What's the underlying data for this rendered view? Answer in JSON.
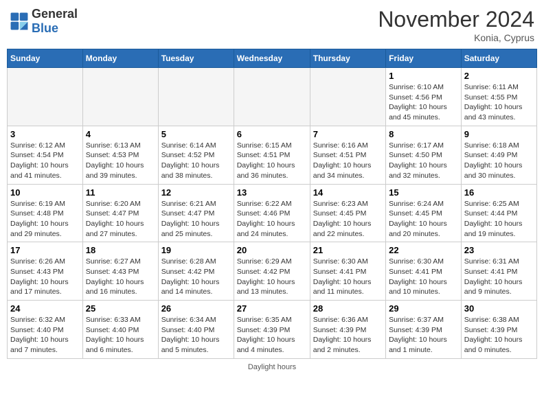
{
  "header": {
    "logo_general": "General",
    "logo_blue": "Blue",
    "title": "November 2024",
    "location": "Konia, Cyprus"
  },
  "days_of_week": [
    "Sunday",
    "Monday",
    "Tuesday",
    "Wednesday",
    "Thursday",
    "Friday",
    "Saturday"
  ],
  "weeks": [
    [
      {
        "day": "",
        "info": ""
      },
      {
        "day": "",
        "info": ""
      },
      {
        "day": "",
        "info": ""
      },
      {
        "day": "",
        "info": ""
      },
      {
        "day": "",
        "info": ""
      },
      {
        "day": "1",
        "info": "Sunrise: 6:10 AM\nSunset: 4:56 PM\nDaylight: 10 hours and 45 minutes."
      },
      {
        "day": "2",
        "info": "Sunrise: 6:11 AM\nSunset: 4:55 PM\nDaylight: 10 hours and 43 minutes."
      }
    ],
    [
      {
        "day": "3",
        "info": "Sunrise: 6:12 AM\nSunset: 4:54 PM\nDaylight: 10 hours and 41 minutes."
      },
      {
        "day": "4",
        "info": "Sunrise: 6:13 AM\nSunset: 4:53 PM\nDaylight: 10 hours and 39 minutes."
      },
      {
        "day": "5",
        "info": "Sunrise: 6:14 AM\nSunset: 4:52 PM\nDaylight: 10 hours and 38 minutes."
      },
      {
        "day": "6",
        "info": "Sunrise: 6:15 AM\nSunset: 4:51 PM\nDaylight: 10 hours and 36 minutes."
      },
      {
        "day": "7",
        "info": "Sunrise: 6:16 AM\nSunset: 4:51 PM\nDaylight: 10 hours and 34 minutes."
      },
      {
        "day": "8",
        "info": "Sunrise: 6:17 AM\nSunset: 4:50 PM\nDaylight: 10 hours and 32 minutes."
      },
      {
        "day": "9",
        "info": "Sunrise: 6:18 AM\nSunset: 4:49 PM\nDaylight: 10 hours and 30 minutes."
      }
    ],
    [
      {
        "day": "10",
        "info": "Sunrise: 6:19 AM\nSunset: 4:48 PM\nDaylight: 10 hours and 29 minutes."
      },
      {
        "day": "11",
        "info": "Sunrise: 6:20 AM\nSunset: 4:47 PM\nDaylight: 10 hours and 27 minutes."
      },
      {
        "day": "12",
        "info": "Sunrise: 6:21 AM\nSunset: 4:47 PM\nDaylight: 10 hours and 25 minutes."
      },
      {
        "day": "13",
        "info": "Sunrise: 6:22 AM\nSunset: 4:46 PM\nDaylight: 10 hours and 24 minutes."
      },
      {
        "day": "14",
        "info": "Sunrise: 6:23 AM\nSunset: 4:45 PM\nDaylight: 10 hours and 22 minutes."
      },
      {
        "day": "15",
        "info": "Sunrise: 6:24 AM\nSunset: 4:45 PM\nDaylight: 10 hours and 20 minutes."
      },
      {
        "day": "16",
        "info": "Sunrise: 6:25 AM\nSunset: 4:44 PM\nDaylight: 10 hours and 19 minutes."
      }
    ],
    [
      {
        "day": "17",
        "info": "Sunrise: 6:26 AM\nSunset: 4:43 PM\nDaylight: 10 hours and 17 minutes."
      },
      {
        "day": "18",
        "info": "Sunrise: 6:27 AM\nSunset: 4:43 PM\nDaylight: 10 hours and 16 minutes."
      },
      {
        "day": "19",
        "info": "Sunrise: 6:28 AM\nSunset: 4:42 PM\nDaylight: 10 hours and 14 minutes."
      },
      {
        "day": "20",
        "info": "Sunrise: 6:29 AM\nSunset: 4:42 PM\nDaylight: 10 hours and 13 minutes."
      },
      {
        "day": "21",
        "info": "Sunrise: 6:30 AM\nSunset: 4:41 PM\nDaylight: 10 hours and 11 minutes."
      },
      {
        "day": "22",
        "info": "Sunrise: 6:30 AM\nSunset: 4:41 PM\nDaylight: 10 hours and 10 minutes."
      },
      {
        "day": "23",
        "info": "Sunrise: 6:31 AM\nSunset: 4:41 PM\nDaylight: 10 hours and 9 minutes."
      }
    ],
    [
      {
        "day": "24",
        "info": "Sunrise: 6:32 AM\nSunset: 4:40 PM\nDaylight: 10 hours and 7 minutes."
      },
      {
        "day": "25",
        "info": "Sunrise: 6:33 AM\nSunset: 4:40 PM\nDaylight: 10 hours and 6 minutes."
      },
      {
        "day": "26",
        "info": "Sunrise: 6:34 AM\nSunset: 4:40 PM\nDaylight: 10 hours and 5 minutes."
      },
      {
        "day": "27",
        "info": "Sunrise: 6:35 AM\nSunset: 4:39 PM\nDaylight: 10 hours and 4 minutes."
      },
      {
        "day": "28",
        "info": "Sunrise: 6:36 AM\nSunset: 4:39 PM\nDaylight: 10 hours and 2 minutes."
      },
      {
        "day": "29",
        "info": "Sunrise: 6:37 AM\nSunset: 4:39 PM\nDaylight: 10 hours and 1 minute."
      },
      {
        "day": "30",
        "info": "Sunrise: 6:38 AM\nSunset: 4:39 PM\nDaylight: 10 hours and 0 minutes."
      }
    ]
  ],
  "footer": "Daylight hours"
}
